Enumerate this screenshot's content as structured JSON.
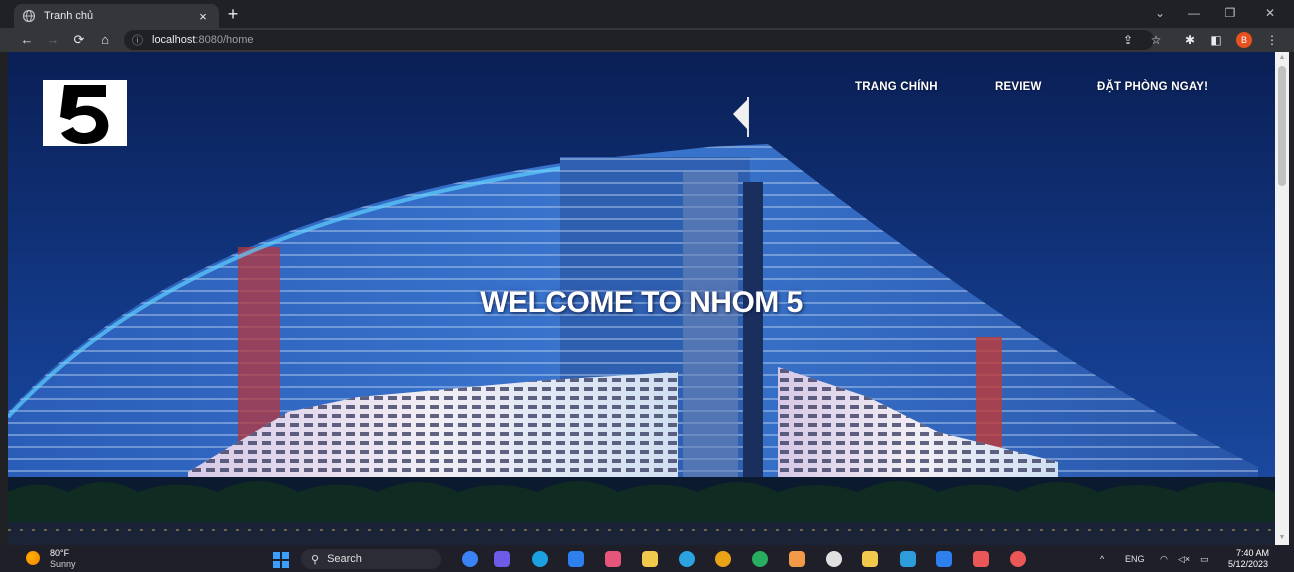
{
  "browser": {
    "tab_title": "Tranh chủ",
    "tab_close": "×",
    "new_tab": "+",
    "url_host": "localhost",
    "url_path": ":8080/home",
    "profile_initial": "B"
  },
  "page": {
    "logo_text": "5",
    "nav": {
      "home": "TRANG CHÍNH",
      "review": "REVIEW",
      "book": "ĐẶT PHÒNG NGAY!"
    },
    "welcome": "WELCOME TO NHOM 5"
  },
  "taskbar": {
    "weather_temp": "80°F",
    "weather_desc": "Sunny",
    "search_label": "Search",
    "language": "ENG",
    "time": "7:40 AM",
    "date": "5/12/2023"
  },
  "colors": {
    "accent_profile": "#e8501f",
    "sky": "#0c2a66"
  }
}
